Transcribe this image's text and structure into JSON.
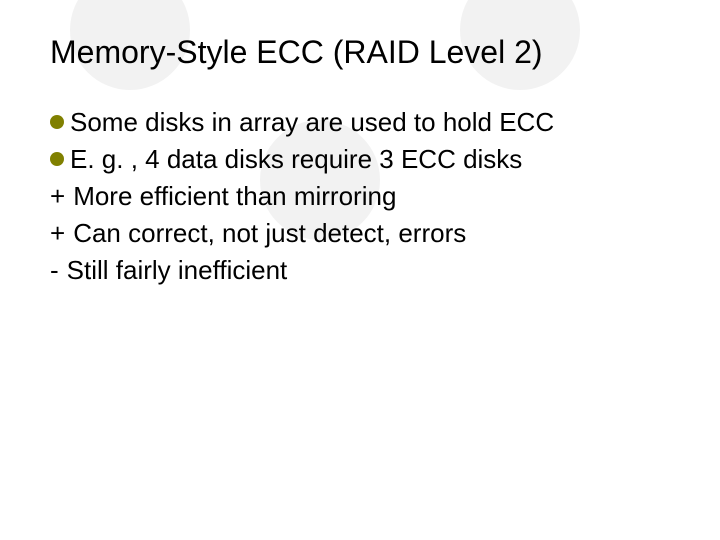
{
  "title": "Memory-Style ECC (RAID Level 2)",
  "bullets": {
    "b0": "Some disks in array are used to hold ECC",
    "b1": "E. g. , 4 data disks require 3 ECC disks",
    "b2": "More efficient than mirroring",
    "b3": "Can correct, not just detect, errors",
    "b4": "Still fairly inefficient"
  },
  "prefix": {
    "plus": "+",
    "minus": "-"
  }
}
